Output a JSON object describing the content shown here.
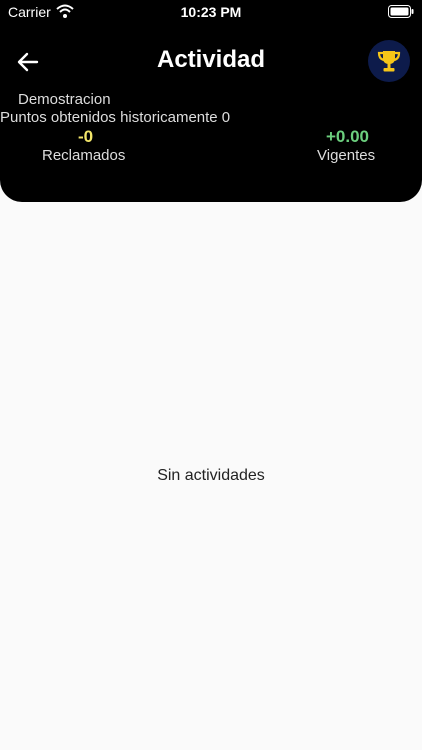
{
  "status_bar": {
    "carrier": "Carrier",
    "time": "10:23 PM",
    "wifi_icon": "wifi-icon",
    "battery_icon": "battery-icon"
  },
  "header": {
    "title": "Actividad",
    "back_icon": "arrow-left-icon",
    "trophy_icon": "trophy-icon",
    "user_name": "Demostracion",
    "historic_points": "Puntos obtenidos historicamente 0",
    "claimed": {
      "value": "-0",
      "label": "Reclamados"
    },
    "current": {
      "value": "+0.00",
      "label": "Vigentes"
    }
  },
  "content": {
    "empty_message": "Sin actividades"
  },
  "colors": {
    "header_bg": "#000000",
    "page_bg": "#fafafa",
    "claimed_value": "#f3e66a",
    "current_value": "#6ccf7e",
    "trophy_bg": "#0d1b4b",
    "trophy_gold": "#f5c518"
  }
}
